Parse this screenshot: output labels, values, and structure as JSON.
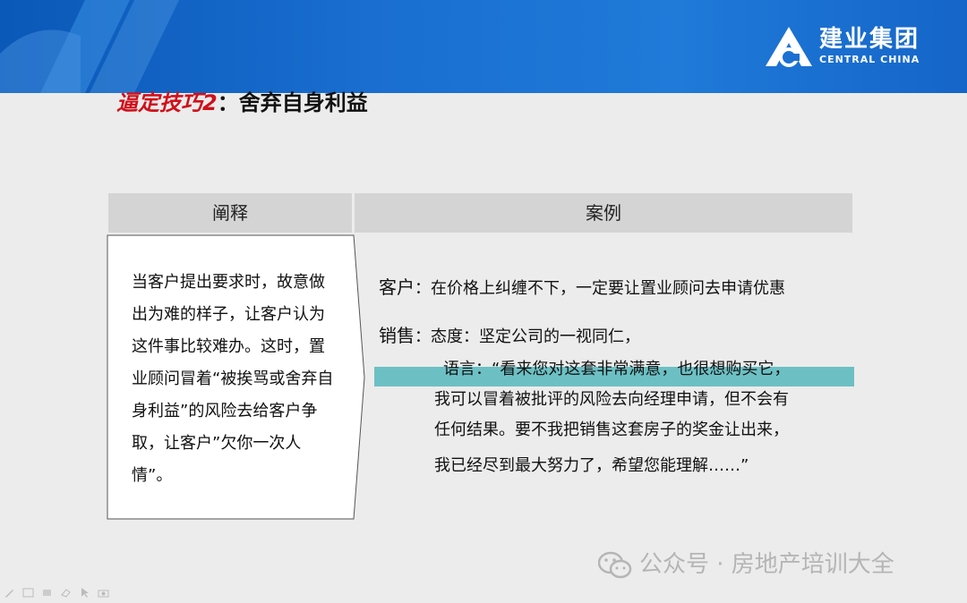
{
  "logo": {
    "name_cn": "建业集团",
    "name_en": "CENTRAL CHINA",
    "icon": "central-china-logo-icon"
  },
  "title": {
    "prefix": "逼定技巧2",
    "separator": "：",
    "main": "舍弃自身利益"
  },
  "table": {
    "left_header": "阐释",
    "right_header": "案例",
    "left_body": "当客户提出要求时，故意做出为难的样子，让客户认为这件事比较难办。这时，置业顾问冒着“被挨骂或舍弃自身利益”的风险去给客户争取，让客户”欠你一次人情”。",
    "case": {
      "customer_label": "客户",
      "customer_text": "：在价格上纠缠不下，一定要让置业顾问去申请优惠",
      "sales_label": "销售",
      "sales_text": "：态度：坚定公司的一视同仁，",
      "speech_line_1": "语言：“看来您对这套非常满意，也很想购买它，",
      "speech_line_2": "我可以冒着被批评的风险去向经理申请，但不会有",
      "speech_line_3": "任何结果。要不我把销售这套房子的奖金让出来，",
      "speech_line_4": "我已经尽到最大努力了，希望您能理解……”"
    }
  },
  "watermark": {
    "text": "公众号 · 房地产培训大全",
    "icon": "wechat-icon"
  },
  "colors": {
    "banner": "#1a6fd0",
    "title_red": "#d0101a",
    "header_bg": "#d4d4d4",
    "highlight": "#6cc0c4",
    "slide_bg": "#ececec"
  },
  "toolbar": {
    "icons": [
      "pen-icon",
      "slides-icon",
      "marker-icon",
      "eraser-icon",
      "pointer-icon",
      "camera-icon"
    ]
  }
}
